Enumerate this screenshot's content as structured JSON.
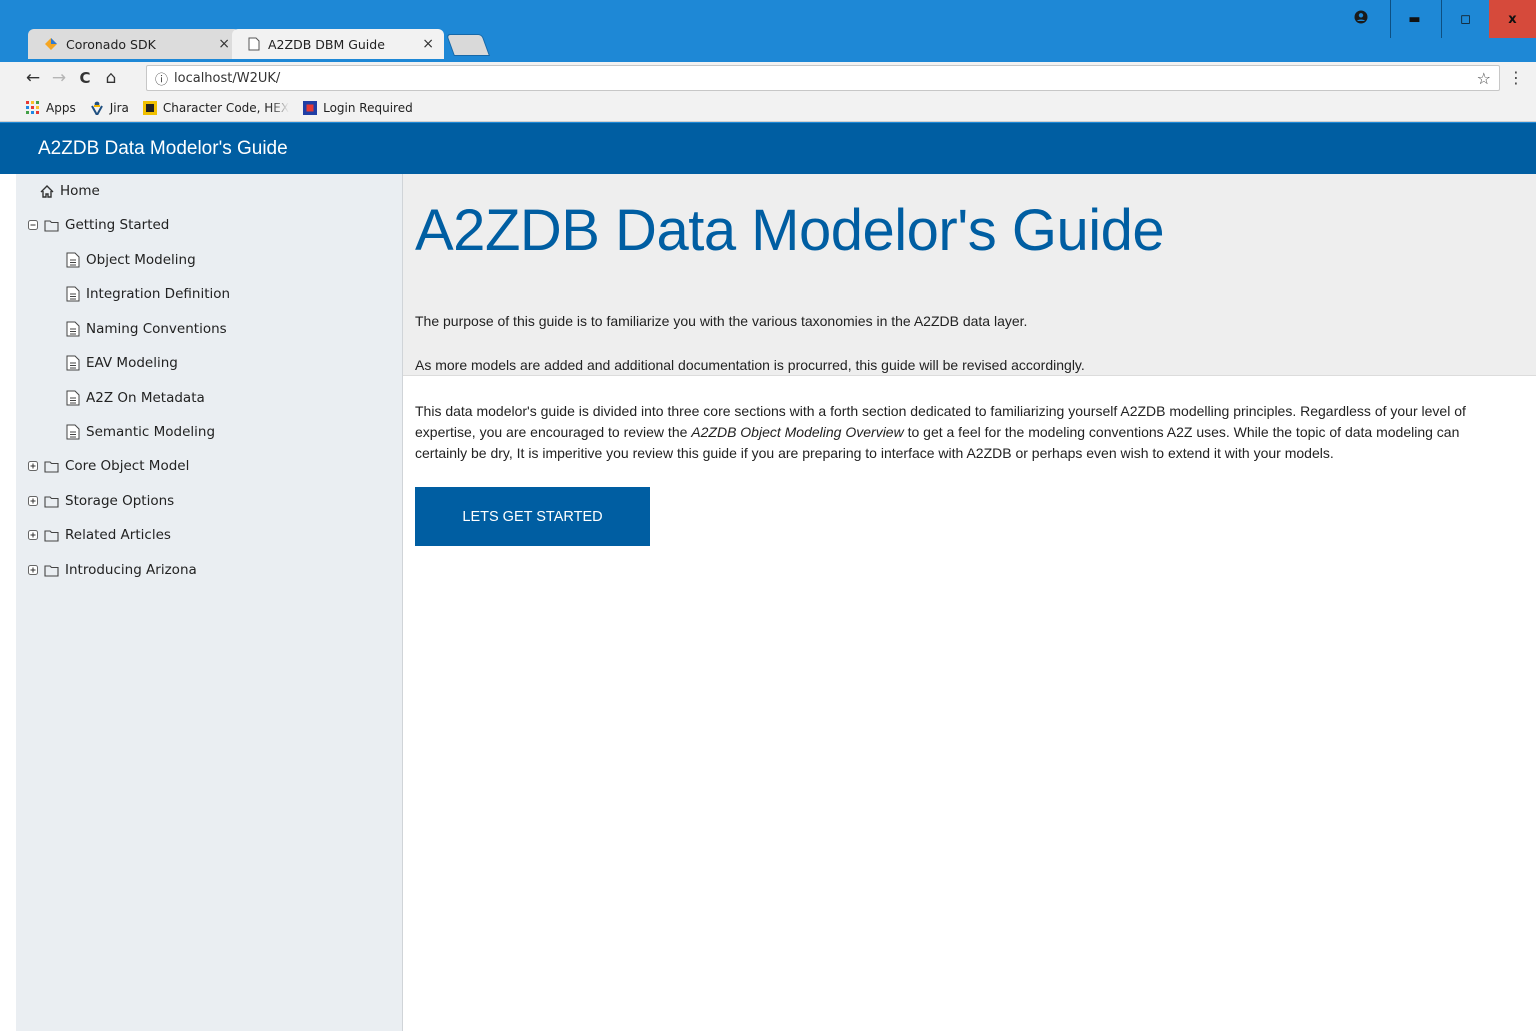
{
  "browser": {
    "tabs": [
      {
        "label": "Coronado SDK",
        "close": "×"
      },
      {
        "label": "A2ZDB DBM Guide",
        "close": "×"
      }
    ],
    "window_controls": {
      "minimize": "▬",
      "maximize": "◻",
      "close": "x"
    },
    "nav": {
      "back": "←",
      "forward": "→",
      "reload": "C",
      "home": "⌂"
    },
    "address": {
      "info": "ⓘ",
      "url": "localhost/W2UK/",
      "star": "☆"
    },
    "menu": "⋮",
    "bookmarks": [
      {
        "label": "Apps",
        "icon": "apps-grid-icon"
      },
      {
        "label": "Jira",
        "icon": "jira-icon"
      },
      {
        "label": "Character Code, HEX",
        "icon": "charcode-icon"
      },
      {
        "label": "Login Required",
        "icon": "login-icon"
      }
    ]
  },
  "app": {
    "title": "A2ZDB Data Modelor's Guide",
    "sidebar": {
      "home": "Home",
      "getting_started": {
        "label": "Getting Started",
        "children": [
          "Object Modeling",
          "Integration Definition",
          "Naming Conventions",
          "EAV Modeling",
          "A2Z On Metadata",
          "Semantic Modeling"
        ]
      },
      "folders": [
        "Core Object Model",
        "Storage Options",
        "Related Articles",
        "Introducing Arizona"
      ]
    },
    "main": {
      "heading": "A2ZDB Data Modelor's Guide",
      "intro1": "The purpose of this guide is to familiarize you with the various taxonomies in the A2ZDB data layer.",
      "intro2": "As more models are added and additional documentation is procurred, this guide will be revised accordingly.",
      "body_part1": "This data modelor's guide is divided into three core sections with a forth section dedicated to familiarizing yourself A2ZDB modelling principles. Regardless of your level of expertise, you are encouraged to review the ",
      "body_emphasis": "A2ZDB Object Modeling Overview",
      "body_part2": " to get a feel for the modeling conventions A2Z uses. While the topic of data modeling can certainly be dry, It is imperitive you review this guide if you are preparing to interface with A2ZDB or perhaps even wish to extend it with your models.",
      "cta_label": "LETS GET STARTED"
    }
  },
  "colors": {
    "chrome": "#1e88d6",
    "appbar": "#005ea2",
    "heading": "#005ea2",
    "sidebar_bg": "#eaeef2",
    "close_button": "#d64a3b"
  }
}
